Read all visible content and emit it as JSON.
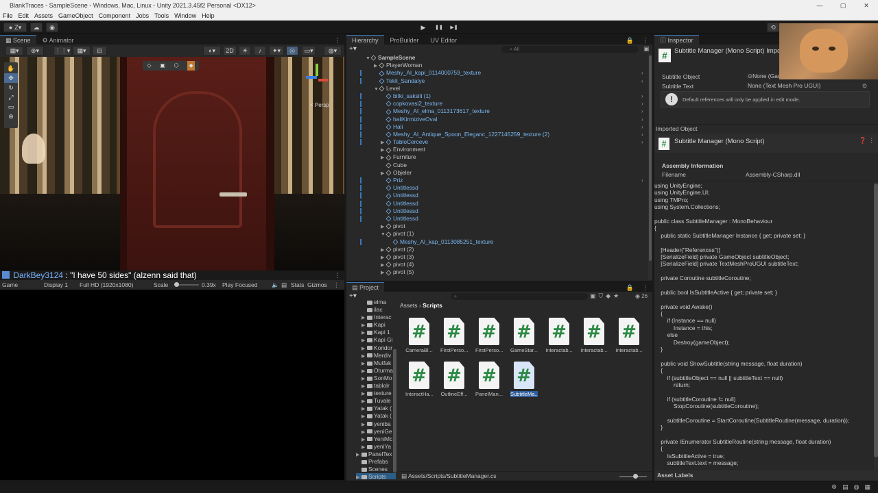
{
  "window": {
    "title": "BlankTraces - SampleScene - Windows, Mac, Linux - Unity 2021.3.45f2 Personal <DX12>",
    "minimize": "—",
    "maximize": "▢",
    "close": "✕"
  },
  "menu": [
    "File",
    "Edit",
    "Assets",
    "GameObject",
    "Component",
    "Jobs",
    "Tools",
    "Window",
    "Help"
  ],
  "toolbar": {
    "account": "Z",
    "play": "▶",
    "pause": "❚❚",
    "step": "▶❚"
  },
  "scene": {
    "tabs": [
      "Scene",
      "Animator"
    ],
    "mode2d": "2D",
    "persp": "< Persp"
  },
  "chat": {
    "user": "DarkBey3124",
    "sep": ":",
    "message": "\"I have 50 sides\" (alzenn said that)"
  },
  "game": {
    "tab": "Game",
    "display": "Display 1",
    "resolution": "Full HD (1920x1080)",
    "scale_label": "Scale",
    "scale_value": "0.39x",
    "play_focused": "Play Focused",
    "stats": "Stats",
    "gizmos": "Gizmos"
  },
  "hierarchy": {
    "tabs": [
      "Hierarchy",
      "ProBuilder",
      "UV Editor"
    ],
    "search_placeholder": "All",
    "rows": [
      {
        "label": "SampleScene",
        "depth": 0,
        "arrow": "▼",
        "blue": false,
        "scene": true
      },
      {
        "label": "PlayerWoman",
        "depth": 1,
        "arrow": "▶",
        "blue": false
      },
      {
        "label": "Meshy_AI_kapi_0114000759_texture",
        "depth": 1,
        "arrow": "",
        "blue": true
      },
      {
        "label": "Tekli_Sandalye",
        "depth": 1,
        "arrow": "",
        "blue": true
      },
      {
        "label": "Level",
        "depth": 1,
        "arrow": "▼",
        "blue": false
      },
      {
        "label": "bitki_saksili (1)",
        "depth": 2,
        "arrow": "",
        "blue": true
      },
      {
        "label": "copkovasi2_texture",
        "depth": 2,
        "arrow": "",
        "blue": true
      },
      {
        "label": "Meshy_AI_elma_0113173617_texture",
        "depth": 2,
        "arrow": "",
        "blue": true
      },
      {
        "label": "haliKirmiziveOval",
        "depth": 2,
        "arrow": "",
        "blue": true
      },
      {
        "label": "Hali",
        "depth": 2,
        "arrow": "",
        "blue": true
      },
      {
        "label": "Meshy_AI_Antique_Spoon_Eleganc_1227145259_texture (2)",
        "depth": 2,
        "arrow": "",
        "blue": true
      },
      {
        "label": "TabloCerceve",
        "depth": 2,
        "arrow": "▶",
        "blue": true
      },
      {
        "label": "Environment",
        "depth": 2,
        "arrow": "▶",
        "blue": false
      },
      {
        "label": "Furniture",
        "depth": 2,
        "arrow": "▶",
        "blue": false
      },
      {
        "label": "Cube",
        "depth": 2,
        "arrow": "",
        "blue": false
      },
      {
        "label": "Objeler",
        "depth": 2,
        "arrow": "▶",
        "blue": false
      },
      {
        "label": "Priz",
        "depth": 2,
        "arrow": "",
        "blue": true
      },
      {
        "label": "Untitlessd",
        "depth": 2,
        "arrow": "",
        "blue": true
      },
      {
        "label": "Untitlessd",
        "depth": 2,
        "arrow": "",
        "blue": true
      },
      {
        "label": "Untitlessd",
        "depth": 2,
        "arrow": "",
        "blue": true
      },
      {
        "label": "Untitlessd",
        "depth": 2,
        "arrow": "",
        "blue": true
      },
      {
        "label": "Untitlessd",
        "depth": 2,
        "arrow": "",
        "blue": true
      },
      {
        "label": "pivot",
        "depth": 2,
        "arrow": "▶",
        "blue": false
      },
      {
        "label": "pivot (1)",
        "depth": 2,
        "arrow": "▼",
        "blue": false
      },
      {
        "label": "Meshy_AI_kap_0113085251_texture",
        "depth": 3,
        "arrow": "",
        "blue": true
      },
      {
        "label": "pivot (2)",
        "depth": 2,
        "arrow": "▶",
        "blue": false
      },
      {
        "label": "pivot (3)",
        "depth": 2,
        "arrow": "▶",
        "blue": false
      },
      {
        "label": "pivot (4)",
        "depth": 2,
        "arrow": "▶",
        "blue": false
      },
      {
        "label": "pivot (5)",
        "depth": 2,
        "arrow": "▶",
        "blue": false
      }
    ]
  },
  "project": {
    "tab": "Project",
    "count": "26",
    "breadcrumb": [
      "Assets",
      "Scripts"
    ],
    "folders": [
      "elma",
      "ilac",
      "Interac",
      "Kapi",
      "Kapi 1",
      "Kapi Gi",
      "Koridor",
      "Merdiv",
      "Mutfak",
      "Oturma",
      "SonMo",
      "tablolr",
      "texture",
      "Tuvale",
      "Yatak (",
      "Yatak (",
      "yeniba",
      "yeniGe",
      "YeniMc",
      "yeniYa",
      "PanelTex",
      "Prefabs",
      "Scenes",
      "Scripts"
    ],
    "files": [
      "CameraBl...",
      "FirstPerso...",
      "FirstPerso...",
      "GameStar...",
      "Interactab...",
      "Interactab...",
      "Interactab...",
      "InteractHa...",
      "OutlineEff...",
      "PanelMan...",
      "SubtitleMa..."
    ],
    "selected_file": "SubtitleMa...",
    "status_path": "Assets/Scripts/SubtitleManager.cs"
  },
  "inspector": {
    "tab": "Inspector",
    "header_title": "Subtitle Manager (Mono Script) Impo",
    "fields": [
      {
        "label": "Subtitle Object",
        "value": "None (Gan"
      },
      {
        "label": "Subtitle Text",
        "value": "None (Text Mesh Pro UGUI)"
      }
    ],
    "warning": "Default references will only be applied in edit mode.",
    "imported_object": "Imported Object",
    "imported_title": "Subtitle Manager (Mono Script)",
    "assembly_info": "Assembly Information",
    "filename_label": "Filename",
    "filename_value": "Assembly-CSharp.dll",
    "asset_labels": "Asset Labels",
    "code_lines": [
      "using UnityEngine;",
      "using UnityEngine.UI;",
      "using TMPro;",
      "using System.Collections;",
      "",
      "public class SubtitleManager : MonoBehaviour",
      "{",
      "    public static SubtitleManager Instance { get; private set; }",
      "",
      "    [Header(\"References\")]",
      "    [SerializeField] private GameObject subtitleObject;",
      "    [SerializeField] private TextMeshProUGUI subtitleText;",
      "",
      "    private Coroutine subtitleCoroutine;",
      "",
      "    public bool IsSubtitleActive { get; private set; }",
      "",
      "    private void Awake()",
      "    {",
      "        if (Instance == null)",
      "            Instance = this;",
      "        else",
      "            Destroy(gameObject);",
      "    }",
      "",
      "    public void ShowSubtitle(string message, float duration)",
      "    {",
      "        if (subtitleObject == null || subtitleText == null)",
      "            return;",
      "",
      "        if (subtitleCoroutine != null)",
      "            StopCoroutine(subtitleCoroutine);",
      "",
      "        subtitleCoroutine = StartCoroutine(SubtitleRoutine(message, duration));",
      "    }",
      "",
      "    private IEnumerator SubtitleRoutine(string message, float duration)",
      "    {",
      "        IsSubtitleActive = true;",
      "        subtitleText.text = message;"
    ]
  }
}
